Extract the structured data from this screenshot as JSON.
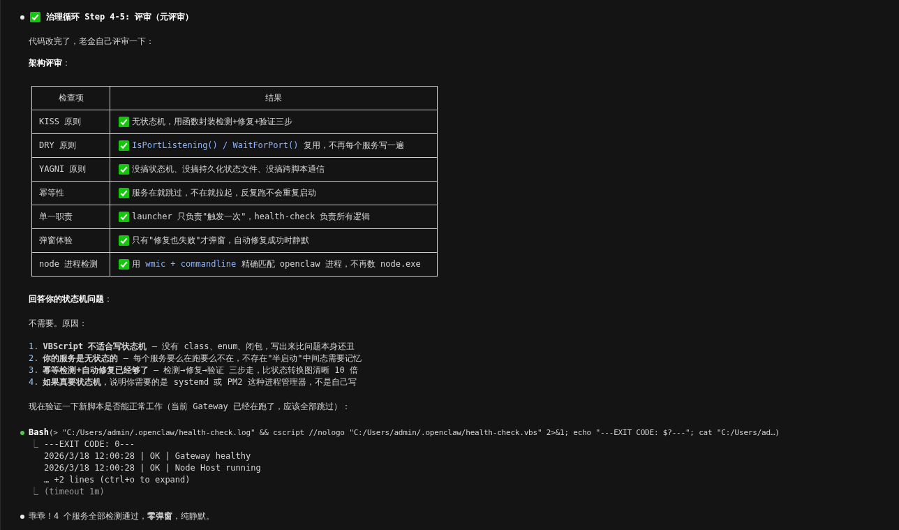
{
  "heading": {
    "check": true,
    "title": "治理循环 Step 4-5: 评审（元评审）"
  },
  "intro": "代码改完了，老金自己评审一下：",
  "review_title": "架构评审",
  "review_colon": "：",
  "table": {
    "columns": [
      "检查项",
      "结果"
    ],
    "rows": [
      {
        "item": "KISS 原则",
        "parts": [
          {
            "kind": "plain",
            "text": "无状态机，用函数封装检测+修复+验证三步"
          }
        ]
      },
      {
        "item": "DRY 原则",
        "parts": [
          {
            "kind": "code",
            "text": "IsPortListening() / WaitForPort()"
          },
          {
            "kind": "plain",
            "text": " 复用，不再每个服务写一遍"
          }
        ]
      },
      {
        "item": "YAGNI 原则",
        "parts": [
          {
            "kind": "plain",
            "text": "没搞状态机、没搞持久化状态文件、没搞跨脚本通信"
          }
        ]
      },
      {
        "item": "幂等性",
        "parts": [
          {
            "kind": "plain",
            "text": "服务在就跳过，不在就拉起，反复跑不会重复启动"
          }
        ]
      },
      {
        "item": "单一职责",
        "parts": [
          {
            "kind": "plain",
            "text": "launcher 只负责\"触发一次\"，health-check 负责所有逻辑"
          }
        ]
      },
      {
        "item": "弹窗体验",
        "parts": [
          {
            "kind": "plain",
            "text": "只有\"修复也失败\"才弹窗，自动修复成功时静默"
          }
        ]
      },
      {
        "item": "node 进程检测",
        "parts": [
          {
            "kind": "plain",
            "text": "用 "
          },
          {
            "kind": "code",
            "text": "wmic + commandline"
          },
          {
            "kind": "plain",
            "text": " 精确匹配 openclaw 进程，不再数 node.exe"
          }
        ]
      }
    ]
  },
  "answer_title": "回答你的状态机问题",
  "answer_colon": "：",
  "answer_lead": "不需要。原因：",
  "reasons": [
    {
      "number": "1.",
      "text": "**VBScript 不适合写状态机** — 没有 class、enum、闭包，写出来比问题本身还丑"
    },
    {
      "number": "2.",
      "text": "**你的服务是无状态的** — 每个服务要么在跑要么不在，不存在\"半启动\"中间态需要记忆"
    },
    {
      "number": "3.",
      "text": "**幂等检测+自动修复已经够了** — 检测→修复→验证 三步走，比状态转换图清晰 10 倍"
    },
    {
      "number": "4.",
      "text": "**如果真要状态机**，说明你需要的是 systemd 或 PM2 这种进程管理器，不是自己写"
    }
  ],
  "verify_note": "现在验证一下新脚本是否能正常工作（当前 Gateway 已经在跑了，应该全部跳过）：",
  "tool_call": {
    "color": "#4ec94e",
    "name": "Bash",
    "command": "(> \"C:/Users/admin/.openclaw/health-check.log\" && cscript //nologo \"C:/Users/admin/.openclaw/health-check.vbs\" 2>&1; echo \"---EXIT CODE: $?---\"; cat \"C:/Users/ad…)",
    "output": [
      "---EXIT CODE: 0---",
      "2026/3/18 12:00:28 | OK | Gateway healthy",
      "2026/3/18 12:00:28 | OK | Node Host running",
      "… +2 lines (ctrl+o to expand)"
    ],
    "timeout": "(timeout 1m)",
    "branch": "⎿"
  },
  "final": "乖乖！4 个服务全部检测通过，**零弹窗**，纯静默。"
}
